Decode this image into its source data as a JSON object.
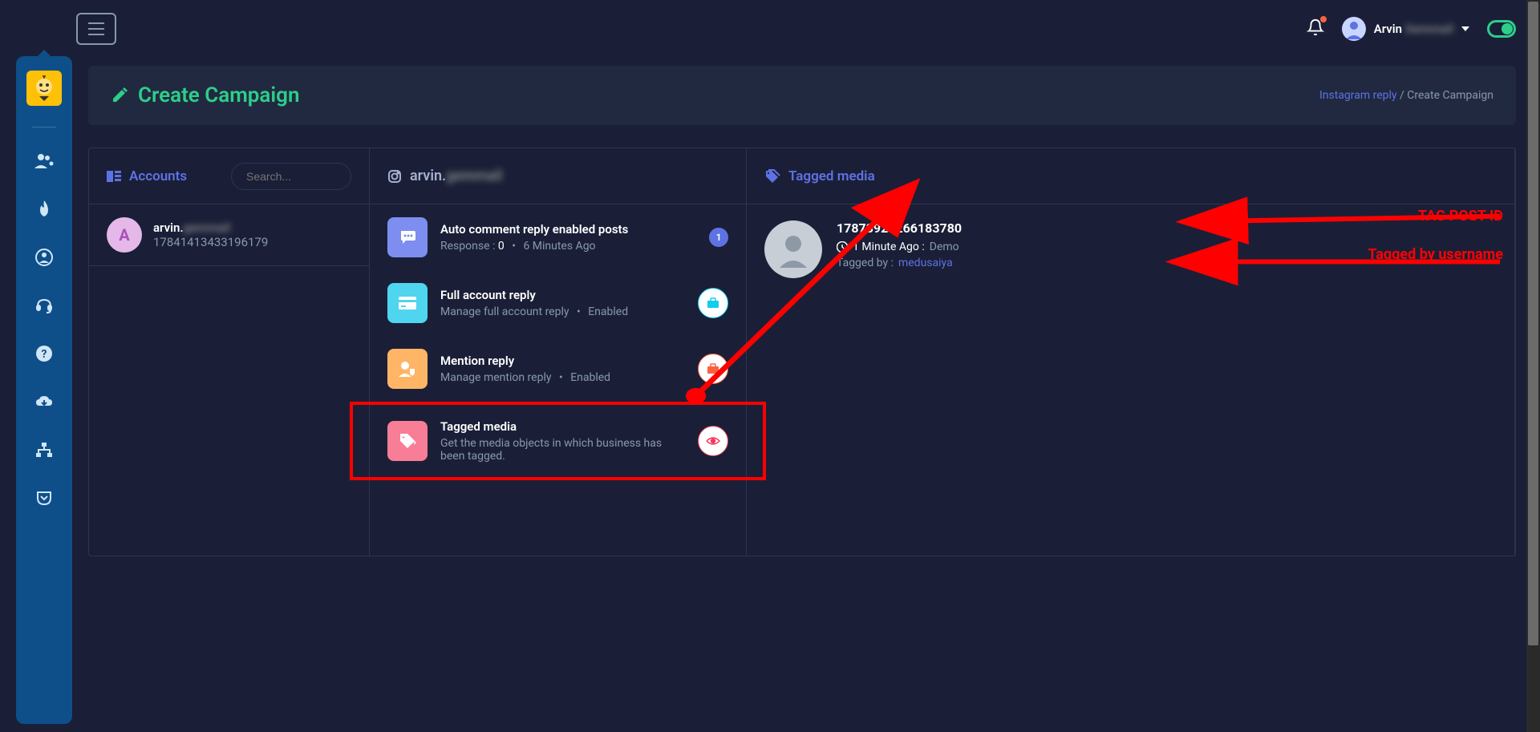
{
  "topbar": {
    "user_name": "Arvin",
    "user_name_extra": "Gemmail"
  },
  "page": {
    "title": "Create Campaign",
    "breadcrumb_link": "Instagram reply",
    "breadcrumb_current": "Create Campaign"
  },
  "col1": {
    "header": "Accounts",
    "search_placeholder": "Search...",
    "account": {
      "initial": "A",
      "name": "arvin.",
      "name_extra": "gemmail",
      "id": "17841413433196179"
    }
  },
  "col2": {
    "header_username": "arvin.",
    "header_extra": "gemmail",
    "items": [
      {
        "title": "Auto comment reply enabled posts",
        "response_label": "Response :",
        "response_value": "0",
        "time": "6 Minutes Ago",
        "badge": "1"
      },
      {
        "title": "Full account reply",
        "sub": "Manage full account reply",
        "status": "Enabled"
      },
      {
        "title": "Mention reply",
        "sub": "Manage mention reply",
        "status": "Enabled"
      },
      {
        "title": "Tagged media",
        "sub": "Get the media objects in which business has been tagged."
      }
    ]
  },
  "col3": {
    "header": "Tagged media",
    "item": {
      "post_id": "17873925266183780",
      "time": "1 Minute Ago :",
      "demo": "Demo",
      "tagged_by_label": "Tagged by :",
      "tagged_by_user": "medusaiya"
    }
  },
  "annotations": {
    "tag_post_id": "TAG POST ID",
    "tagged_by": "Tagged by username"
  },
  "colors": {
    "green": "#2dce89",
    "purple": "#5e72e4",
    "teal": "#11cdef",
    "orange": "#fb6340",
    "pink": "#f5365c"
  }
}
